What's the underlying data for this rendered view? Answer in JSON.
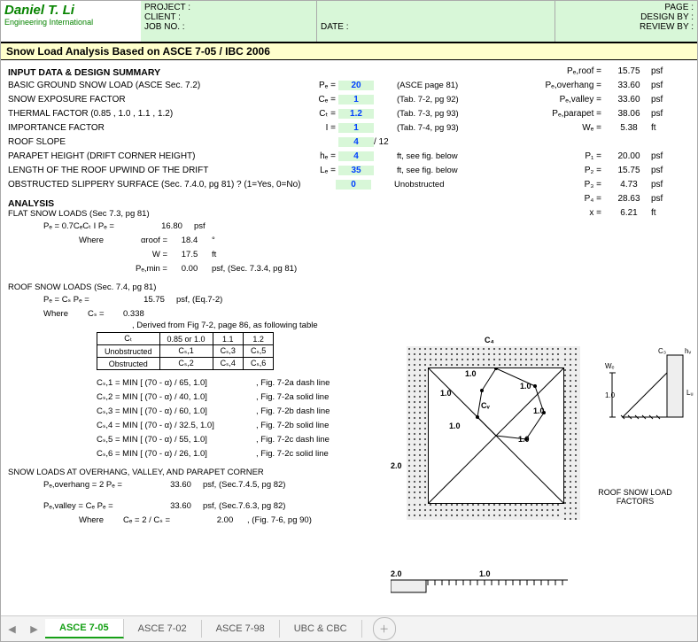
{
  "header": {
    "logo_name": "Daniel T. Li",
    "logo_sub": "Engineering International",
    "project_lbl": "PROJECT :",
    "client_lbl": "CLIENT :",
    "jobno_lbl": "JOB NO. :",
    "date_lbl": "DATE :",
    "page_lbl": "PAGE :",
    "design_lbl": "DESIGN BY :",
    "review_lbl": "REVIEW BY :"
  },
  "title": "Snow Load Analysis Based on ASCE 7-05 / IBC 2006",
  "input": {
    "head": "INPUT DATA & DESIGN SUMMARY",
    "rows": [
      {
        "lbl": "BASIC GROUND SNOW LOAD (ASCE Sec. 7.2)",
        "sym": "Pₑ =",
        "val": "20",
        "note": "(ASCE page 81)"
      },
      {
        "lbl": "SNOW EXPOSURE FACTOR",
        "sym": "Cₑ =",
        "val": "1",
        "note": "(Tab. 7-2, pg 92)"
      },
      {
        "lbl": "THERMAL FACTOR (0.85 , 1.0 , 1.1 , 1.2)",
        "sym": "Cₜ =",
        "val": "1.2",
        "note": "(Tab. 7-3, pg 93)"
      },
      {
        "lbl": "IMPORTANCE FACTOR",
        "sym": "I =",
        "val": "1",
        "note": "(Tab. 7-4, pg 93)"
      }
    ],
    "slope_lbl": "ROOF SLOPE",
    "slope_val": "4",
    "slope_aft": "/ 12",
    "parapet_lbl": "PARAPET HEIGHT (DRIFT CORNER HEIGHT)",
    "parapet_sym": "hₑ =",
    "parapet_val": "4",
    "parapet_note": "ft, see fig. below",
    "upwind_lbl": "LENGTH OF THE ROOF UPWIND OF THE DRIFT",
    "upwind_sym": "Lₑ =",
    "upwind_val": "35",
    "upwind_note": "ft, see fig. below",
    "obstruct_lbl": "OBSTRUCTED SLIPPERY SURFACE (Sec. 7.4.0, pg 81) ?  (1=Yes, 0=No)",
    "obstruct_val": "0",
    "obstruct_note": "Unobstructed"
  },
  "right": {
    "rows": [
      {
        "sym": "Pₑ,roof =",
        "val": "15.75",
        "unit": "psf"
      },
      {
        "sym": "Pₑ,overhang =",
        "val": "33.60",
        "unit": "psf"
      },
      {
        "sym": "Pₑ,valley =",
        "val": "33.60",
        "unit": "psf"
      },
      {
        "sym": "Pₑ,parapet =",
        "val": "38.06",
        "unit": "psf"
      },
      {
        "sym": "Wₑ =",
        "val": "5.38",
        "unit": "ft"
      },
      {
        "sym": "",
        "val": "",
        "unit": ""
      },
      {
        "sym": "P₁ =",
        "val": "20.00",
        "unit": "psf"
      },
      {
        "sym": "P₂ =",
        "val": "15.75",
        "unit": "psf"
      },
      {
        "sym": "P₃ =",
        "val": "4.73",
        "unit": "psf"
      },
      {
        "sym": "P₄ =",
        "val": "28.63",
        "unit": "psf"
      },
      {
        "sym": "x =",
        "val": "6.21",
        "unit": "ft"
      }
    ]
  },
  "analysis": {
    "head": "ANALYSIS",
    "flat_head": "FLAT SNOW LOADS (Sec 7.3, pg 81)",
    "pf_eq": "Pₑ = 0.7CₑCₜ I Pₑ =",
    "pf_val": "16.80",
    "pf_unit": "psf",
    "where": "Where",
    "alpha_sym": "αroof =",
    "alpha_val": "18.4",
    "alpha_unit": "°",
    "w_sym": "W =",
    "w_val": "17.5",
    "w_unit": "ft",
    "pfmin_sym": "Pₑ,min =",
    "pfmin_val": "0.00",
    "pfmin_unit": "psf, (Sec. 7.3.4, pg 81)"
  },
  "roof": {
    "head": "ROOF SNOW LOADS (Sec. 7.4, pg 81)",
    "pe_eq": "Pₑ = Cₛ Pₑ =",
    "pe_val": "15.75",
    "pe_unit": "psf, (Eq.7-2)",
    "where": "Where",
    "cs_sym": "Cₛ =",
    "cs_val": "0.338",
    "table_caption": ", Derived from Fig 7-2, page 86, as following table",
    "table_head": [
      "Cₜ",
      "0.85 or 1.0",
      "1.1",
      "1.2"
    ],
    "table_rows": [
      [
        "Unobstructed",
        "Cₛ,1",
        "Cₛ,3",
        "Cₛ,5"
      ],
      [
        "Obstructed",
        "Cₛ,2",
        "Cₛ,4",
        "Cₛ,6"
      ]
    ],
    "formulas": [
      {
        "f": "Cₛ,1 = MIN [ (70 - α) / 65, 1.0]",
        "ref": ", Fig. 7-2a dash line"
      },
      {
        "f": "Cₛ,2 = MIN [ (70 - α) / 40, 1.0]",
        "ref": ", Fig. 7-2a solid line"
      },
      {
        "f": "Cₛ,3 = MIN [ (70 - α) / 60, 1.0]",
        "ref": ", Fig. 7-2b dash line"
      },
      {
        "f": "Cₛ,4 = MIN [ (70 - α) / 32.5, 1.0]",
        "ref": ", Fig. 7-2b solid line"
      },
      {
        "f": "Cₛ,5 = MIN [ (70 - α) / 55, 1.0]",
        "ref": ", Fig. 7-2c dash line"
      },
      {
        "f": "Cₛ,6 = MIN [ (70 - α) / 26, 1.0]",
        "ref": ", Fig. 7-2c solid line"
      }
    ]
  },
  "overhang": {
    "head": "SNOW LOADS AT OVERHANG, VALLEY, AND PARAPET CORNER",
    "o_eq": "Pₑ,overhang = 2 Pₑ =",
    "o_val": "33.60",
    "o_unit": "psf, (Sec.7.4.5, pg 82)",
    "v_eq": "Pₑ,valley = Cₑ Pₑ =",
    "v_val": "33.60",
    "v_unit": "psf, (Sec.7.6.3, pg 82)",
    "where": "Where",
    "ce_sym": "Cₑ = 2 / Cₛ =",
    "ce_val": "2.00",
    "ce_unit": ", (Fig. 7-6, pg 90)"
  },
  "fig": {
    "caption": "ROOF SNOW LOAD FACTORS",
    "labels": {
      "c4": "C₄",
      "c3": "C₃",
      "hv": "hᵥ",
      "wd": "Wₑ",
      "lu": "Lᵤ",
      "v10a": "1.0",
      "v10b": "1.0",
      "v10c": "1.0",
      "v10d": "1.0",
      "v10e": "1.0",
      "v10f": "1.0",
      "v20": "2.0",
      "v20b": "2.0",
      "cv": "Cᵥ"
    }
  },
  "tabs": {
    "items": [
      "ASCE 7-05",
      "ASCE 7-02",
      "ASCE 7-98",
      "UBC & CBC"
    ],
    "active": 0
  }
}
